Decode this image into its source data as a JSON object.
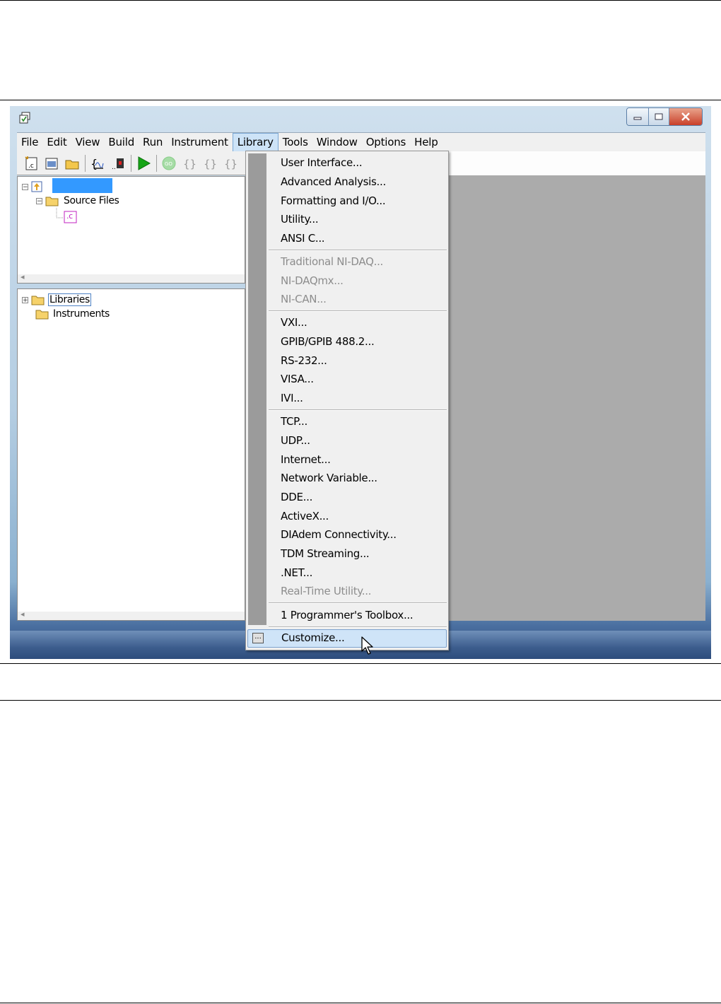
{
  "menubar": {
    "items": [
      "File",
      "Edit",
      "View",
      "Build",
      "Run",
      "Instrument",
      "Library",
      "Tools",
      "Window",
      "Options",
      "Help"
    ],
    "active": "Library"
  },
  "tree": {
    "project_label": "",
    "source_files": "Source Files",
    "libraries": "Libraries",
    "instruments": "Instruments",
    "file_badge": ".c"
  },
  "library_menu": {
    "group1": [
      "User Interface...",
      "Advanced Analysis...",
      "Formatting and I/O...",
      "Utility...",
      "ANSI C..."
    ],
    "group2_disabled": [
      "Traditional NI-DAQ...",
      "NI-DAQmx...",
      "NI-CAN..."
    ],
    "group3": [
      "VXI...",
      "GPIB/GPIB 488.2...",
      "RS-232...",
      "VISA...",
      "IVI..."
    ],
    "group4": [
      "TCP...",
      "UDP...",
      "Internet...",
      "Network Variable...",
      "DDE...",
      "ActiveX...",
      "DIAdem Connectivity...",
      "TDM Streaming...",
      ".NET..."
    ],
    "group4_disabled": "Real-Time Utility...",
    "recent": "1 Programmer's Toolbox...",
    "customize": "Customize...",
    "customize_icon_text": "..."
  },
  "colors": {
    "menubar_bg": "#f0f0f0",
    "workspace_bg": "#ababab",
    "selection": "#3399ff",
    "highlight": "#cfe4f8",
    "disabled_text": "#8d8d8d"
  }
}
